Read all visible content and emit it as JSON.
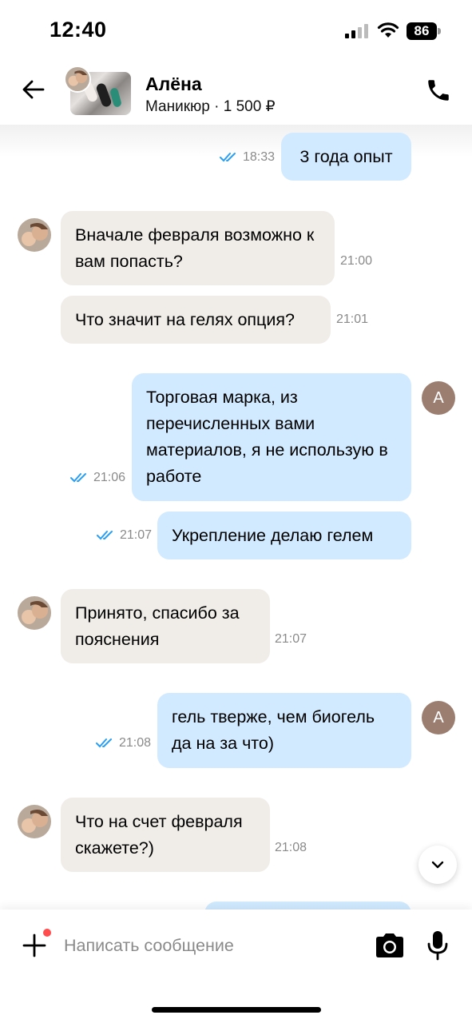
{
  "status_bar": {
    "time": "12:40",
    "battery": "86"
  },
  "header": {
    "name": "Алёна",
    "subtitle": "Маникюр · 1 500 ₽",
    "out_avatar_letter": "А"
  },
  "messages": [
    {
      "dir": "out",
      "text": "3 года опыт",
      "time": "18:33",
      "read": true
    },
    {
      "dir": "in",
      "text": "Вначале февраля возможно к вам попасть?",
      "time": "21:00"
    },
    {
      "dir": "in",
      "text": "Что значит на гелях опция?",
      "time": "21:01"
    },
    {
      "dir": "out",
      "text": "Торговая марка, из перечисленных вами материалов, я не использую в работе",
      "time": "21:06",
      "read": true
    },
    {
      "dir": "out",
      "text": "Укрепление делаю гелем",
      "time": "21:07",
      "read": true
    },
    {
      "dir": "in",
      "text": "Принято, спасибо за пояснения",
      "time": "21:07"
    },
    {
      "dir": "out",
      "text": "гель тверже, чем биогель да на за что)",
      "time": "21:08",
      "read": true
    },
    {
      "dir": "in",
      "text": "Что на счет февраля скажете?)",
      "time": "21:08"
    }
  ],
  "composer": {
    "placeholder": "Написать сообщение"
  },
  "colors": {
    "incoming_bubble": "#f0ede8",
    "outgoing_bubble": "#d1eaff",
    "read_ticks": "#2a9df4",
    "avatar_letter_bg": "#9b7e70",
    "notification_dot": "#ff4d4d"
  },
  "icons": [
    "back-arrow-icon",
    "phone-icon",
    "double-check-icon",
    "chevron-down-icon",
    "plus-icon",
    "camera-icon",
    "microphone-icon",
    "signal-icon",
    "wifi-icon",
    "battery-icon"
  ]
}
